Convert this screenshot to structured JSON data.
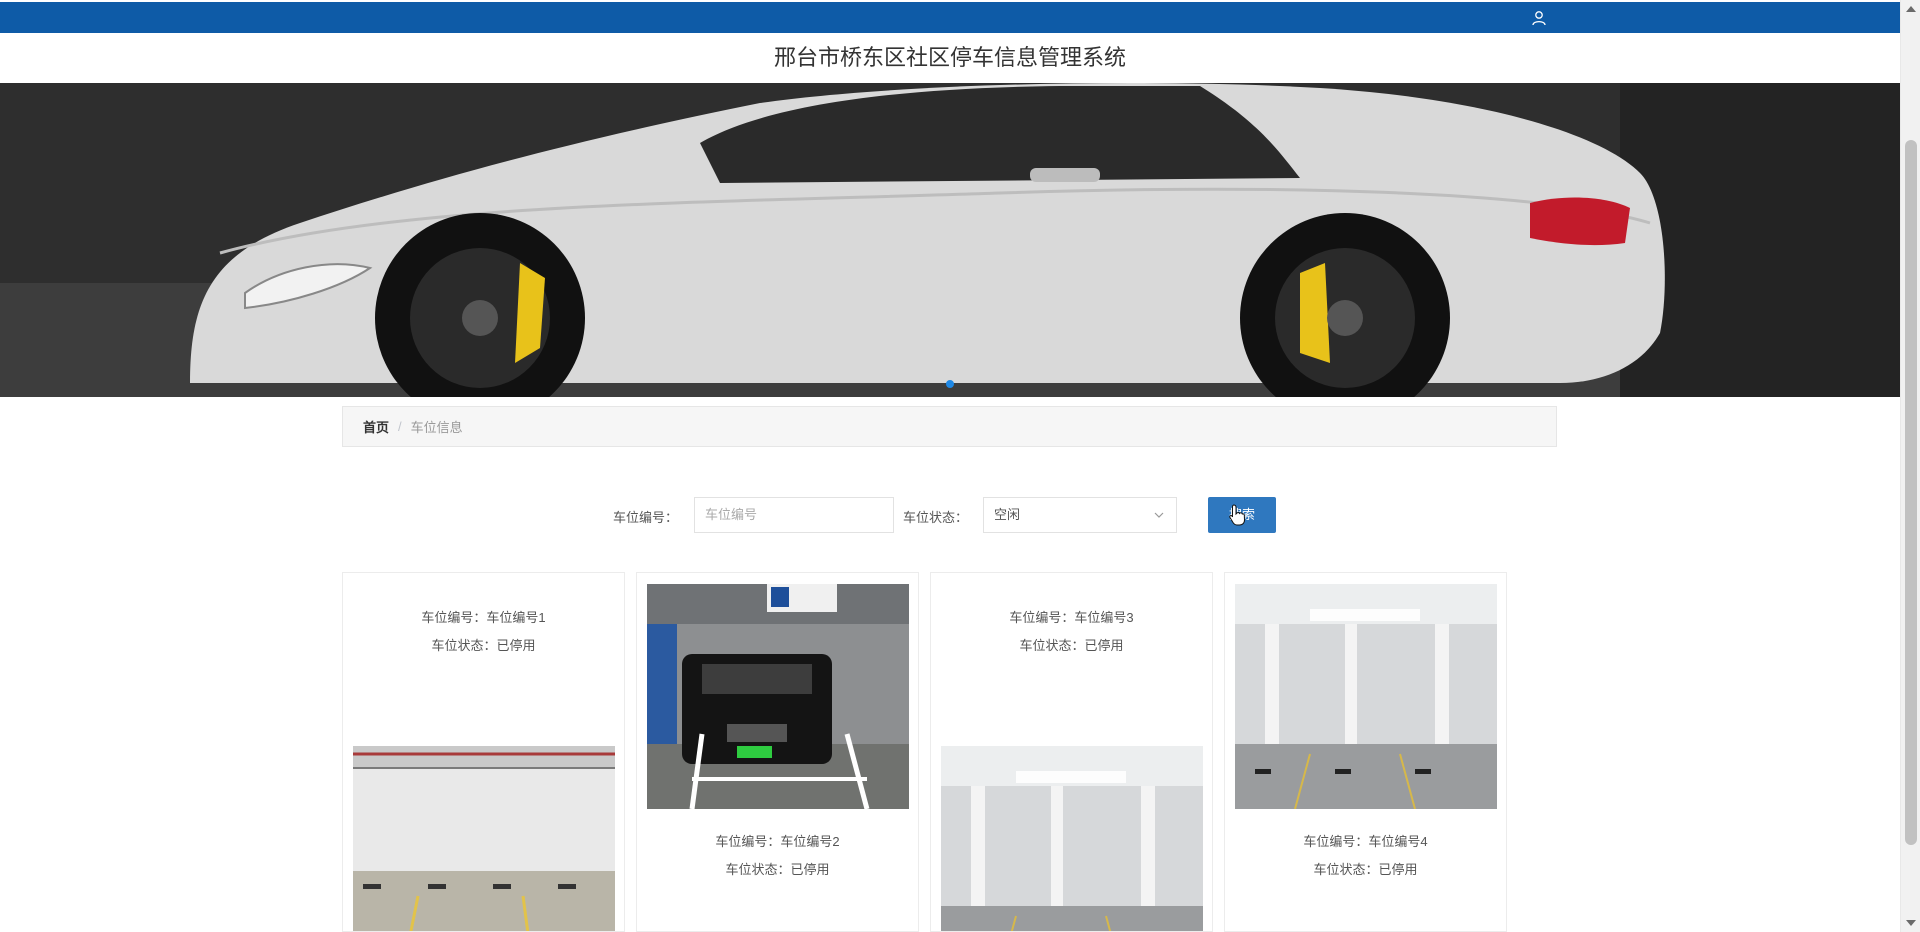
{
  "header": {
    "title": "邢台市桥东区社区停车信息管理系统",
    "user_icon": "user-icon",
    "bar_color": "#0e5ba7"
  },
  "banner": {
    "image": "white-sports-car-photo",
    "active_slide": 1,
    "slide_count": 1
  },
  "breadcrumb": {
    "home": "首页",
    "separator": "/",
    "current": "车位信息"
  },
  "search": {
    "number_label": "车位编号：",
    "number_placeholder": "车位编号",
    "status_label": "车位状态：",
    "status_value": "空闲",
    "button_label": "搜索",
    "button_color": "#2f78bf"
  },
  "cards": [
    {
      "number_line": "车位编号：车位编号1",
      "status_line": "车位状态：已停用",
      "photo": "empty-garage-wall-photo"
    },
    {
      "number_line": "车位编号：车位编号2",
      "status_line": "车位状态：已停用",
      "photo": "parked-black-suv-photo"
    },
    {
      "number_line": "车位编号：车位编号3",
      "status_line": "车位状态：已停用",
      "photo": "underground-parking-photo"
    },
    {
      "number_line": "车位编号：车位编号4",
      "status_line": "车位状态：已停用",
      "photo": "underground-parking-photo"
    }
  ]
}
